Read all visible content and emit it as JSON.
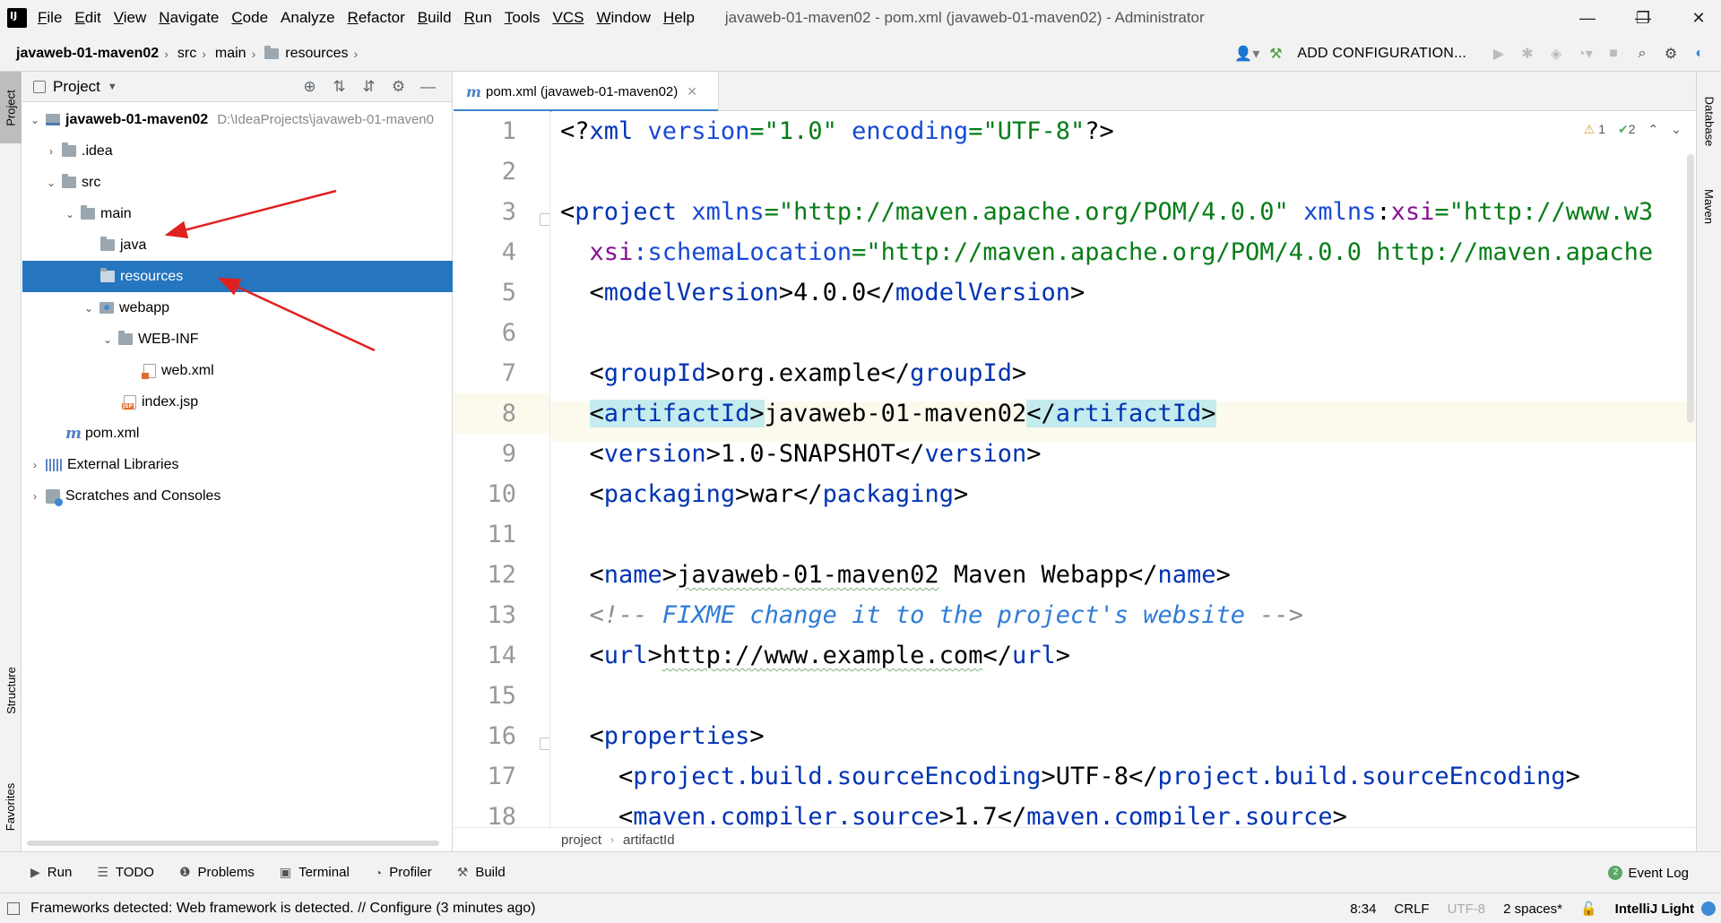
{
  "app": {
    "logo_text": "IJ",
    "window_title": "javaweb-01-maven02 - pom.xml (javaweb-01-maven02) - Administrator"
  },
  "menu": [
    {
      "label": "File",
      "mnemonic": "F",
      "rest": "ile"
    },
    {
      "label": "Edit",
      "mnemonic": "E",
      "rest": "dit"
    },
    {
      "label": "View",
      "mnemonic": "V",
      "rest": "iew"
    },
    {
      "label": "Navigate",
      "mnemonic": "N",
      "rest": "avigate"
    },
    {
      "label": "Code",
      "mnemonic": "C",
      "rest": "ode"
    },
    {
      "label": "Analyze",
      "mnemonic": "",
      "rest": "Analyze"
    },
    {
      "label": "Refactor",
      "mnemonic": "R",
      "rest": "efactor"
    },
    {
      "label": "Build",
      "mnemonic": "B",
      "rest": "uild"
    },
    {
      "label": "Run",
      "mnemonic": "R",
      "rest": "un"
    },
    {
      "label": "Tools",
      "mnemonic": "T",
      "rest": "ools"
    },
    {
      "label": "VCS",
      "mnemonic": "",
      "rest": "VCS"
    },
    {
      "label": "Window",
      "mnemonic": "W",
      "rest": "indow"
    },
    {
      "label": "Help",
      "mnemonic": "H",
      "rest": "elp"
    }
  ],
  "window_controls": {
    "minimize": "—",
    "restore": "❐",
    "close": "✕"
  },
  "nav": {
    "crumbs": [
      "javaweb-01-maven02",
      "src",
      "main",
      "resources"
    ],
    "add_configuration": "ADD CONFIGURATION..."
  },
  "left_stripe": {
    "project": "Project",
    "structure": "Structure",
    "favorites": "Favorites"
  },
  "project_panel": {
    "title": "Project",
    "tree": [
      {
        "label": "javaweb-01-maven02",
        "path": "D:\\IdeaProjects\\javaweb-01-maven0",
        "bold": true
      },
      {
        "label": ".idea"
      },
      {
        "label": "src"
      },
      {
        "label": "main"
      },
      {
        "label": "java"
      },
      {
        "label": "resources",
        "selected": true
      },
      {
        "label": "webapp"
      },
      {
        "label": "WEB-INF"
      },
      {
        "label": "web.xml"
      },
      {
        "label": "index.jsp"
      },
      {
        "label": "pom.xml"
      },
      {
        "label": "External Libraries"
      },
      {
        "label": "Scratches and Consoles"
      }
    ]
  },
  "editor": {
    "tab_label": "pom.xml (javaweb-01-maven02)",
    "tab_icon": "m",
    "line_numbers": [
      "1",
      "2",
      "3",
      "4",
      "5",
      "6",
      "7",
      "8",
      "9",
      "10",
      "11",
      "12",
      "13",
      "14",
      "15",
      "16",
      "17",
      "18"
    ],
    "current_line": "8",
    "inspections": {
      "warnings": "1",
      "ok": "2"
    },
    "code": {
      "l1_a": "<?",
      "l1_b": "xml",
      "l1_c": " version",
      "l1_d": "=\"1.0\"",
      "l1_e": " encoding",
      "l1_f": "=\"UTF-8\"",
      "l1_g": "?>",
      "l3_a": "<",
      "l3_b": "project",
      "l3_c": " xmlns",
      "l3_d": "=\"http://maven.apache.org/POM/4.0.0\"",
      "l3_e": " xmlns",
      "l3_f": ":",
      "l3_g": "xsi",
      "l3_h": "=\"http://www.w3",
      "l4_a": "  xsi",
      "l4_b": ":schemaLocation",
      "l4_c": "=\"http://maven.apache.org/POM/4.0.0 http://maven.apache",
      "l5_tag": "modelVersion",
      "l5_val": "4.0.0",
      "l7_tag": "groupId",
      "l7_val": "org.example",
      "l8_tag": "artifactId",
      "l8_val": "javaweb-01-maven02",
      "l9_tag": "version",
      "l9_val": "1.0-SNAPSHOT",
      "l10_tag": "packaging",
      "l10_val": "war",
      "l12_tag": "name",
      "l12_val": "javaweb-01-maven02",
      "l12_val2": " Maven Webapp",
      "l13_open": "<!-- ",
      "l13_text": "FIXME change it to the project's website",
      "l13_close": " -->",
      "l14_tag": "url",
      "l14_val": "http://www.example.com",
      "l16_tag": "properties",
      "l17_tag": "project.build.sourceEncoding",
      "l17_val": "UTF-8",
      "l18_tag": "maven.compiler.source",
      "l18_val": "1.7"
    },
    "breadcrumb": [
      "project",
      "artifactId"
    ]
  },
  "right_stripe": {
    "database": "Database",
    "maven": "Maven"
  },
  "tool_windows": [
    {
      "label": "Run",
      "icon": "run-icon",
      "glyph": "▶"
    },
    {
      "label": "TODO",
      "icon": "todo-icon",
      "glyph": "☰"
    },
    {
      "label": "Problems",
      "icon": "problems-icon",
      "glyph": "❶"
    },
    {
      "label": "Terminal",
      "icon": "terminal-icon",
      "glyph": "▣"
    },
    {
      "label": "Profiler",
      "icon": "profiler-icon",
      "glyph": "◔"
    },
    {
      "label": "Build",
      "icon": "build-icon",
      "glyph": "⚒"
    }
  ],
  "event_log": {
    "badge": "2",
    "label": "Event Log"
  },
  "status": {
    "message": "Frameworks detected: Web framework is detected. // Configure (3 minutes ago)",
    "position": "8:34",
    "line_sep": "CRLF",
    "encoding": "UTF-8",
    "indent": "2 spaces*",
    "theme": "IntelliJ Light"
  },
  "colors": {
    "selection": "#2675bf",
    "arrow": "#e02020",
    "accent": "#4083c9"
  }
}
